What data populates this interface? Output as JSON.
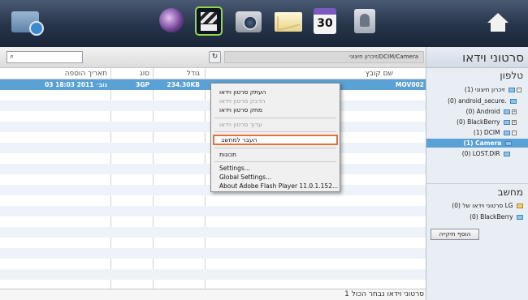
{
  "toolbar": {
    "icons": [
      "pc-sync-icon",
      "music-icon",
      "video-icon",
      "photo-icon",
      "message-icon",
      "calendar-icon",
      "contacts-icon",
      "home-icon"
    ],
    "calendar_day": "30"
  },
  "search": {
    "placeholder": "",
    "icon": "search-icon"
  },
  "path": "DCIM/Camera/זיכרון חיצוני",
  "table": {
    "headers": {
      "name": "שם קובץ",
      "size": "גודל",
      "type": "סוג",
      "date": "תאריך הוספה"
    },
    "rows": [
      {
        "name": "MOV002",
        "size": "234.30KB",
        "type": "3GP",
        "date": "03 נוב׳ 2011 18:03"
      }
    ]
  },
  "status": "1 סרטוני וידאו נבחר הכול",
  "context_menu": {
    "items": [
      {
        "label": "העתק סרטון וידאו",
        "disabled": false
      },
      {
        "label": "הדבק סרטון וידאו",
        "disabled": true
      },
      {
        "label": "מחק סרטון וידאו",
        "disabled": false
      },
      {
        "label": "ערוך סרטון וידאו",
        "disabled": true
      },
      {
        "label": "העבר למחשב",
        "disabled": false,
        "highlighted": true
      },
      {
        "label": "תכונות",
        "disabled": false
      },
      {
        "label": "Settings...",
        "disabled": false
      },
      {
        "label": "Global Settings...",
        "disabled": false
      },
      {
        "label": "About Adobe Flash Player 11.0.1.152...",
        "disabled": false
      }
    ]
  },
  "sidebar": {
    "title": "סרטוני וידאו",
    "phone_section": "טלפון",
    "phone_tree": [
      {
        "label": "(1) זיכרון חיצוני"
      },
      {
        "label": "(0) android_secure."
      },
      {
        "label": "(0) Android"
      },
      {
        "label": "(0) BlackBerry"
      },
      {
        "label": "(1) DCIM"
      },
      {
        "label": "(1) Camera",
        "selected": true
      },
      {
        "label": "(0) LOST.DIR"
      }
    ],
    "computer_section": "מחשב",
    "computer_tree": [
      {
        "label": "(0) סרטוני וידאו של LG"
      },
      {
        "label": "(0) BlackBerry"
      }
    ],
    "add_folder_label": "הוסף תיקייה"
  },
  "colors": {
    "selection": "#5aa1d6",
    "highlight_border": "#e4703a",
    "toolbar": "#26344a"
  }
}
